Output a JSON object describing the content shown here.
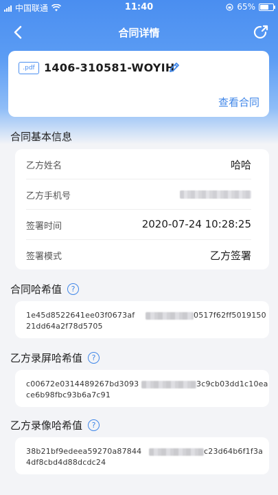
{
  "status_bar": {
    "carrier": "中国联通",
    "time": "11:40",
    "battery": "65%"
  },
  "navbar": {
    "title": "合同详情"
  },
  "contract_card": {
    "file_type": ".pdf",
    "contract_no": "1406-310581-WOYIH",
    "view_link": "查看合同"
  },
  "basic_info": {
    "title": "合同基本信息",
    "rows": [
      {
        "label": "乙方姓名",
        "value": "哈哈"
      },
      {
        "label": "乙方手机号",
        "value": ""
      },
      {
        "label": "签署时间",
        "value": "2020-07-24 10:28:25"
      },
      {
        "label": "签署模式",
        "value": "乙方签署"
      }
    ]
  },
  "hashes": [
    {
      "title": "合同哈希值",
      "line1_start": "1e45d8522641ee03f0673af",
      "line1_end": "0517f62ff5019150",
      "line2": "21dd64a2f78d5705"
    },
    {
      "title": "乙方录屏哈希值",
      "line1_start": "c00672e0314489267bd3093",
      "line1_end": "3c9cb03dd1c10ea",
      "line2": "ce6b98fbc93b6a7c91"
    },
    {
      "title": "乙方录像哈希值",
      "line1_start": "38b21bf9edeea59270a87844",
      "line1_end": "c23d64b6f1f3a",
      "line2": "4df8cbd4d88dcdc24"
    }
  ],
  "colors": {
    "accent": "#3f86e8",
    "header": "#4a8ef0",
    "background": "#f3f4f7"
  }
}
